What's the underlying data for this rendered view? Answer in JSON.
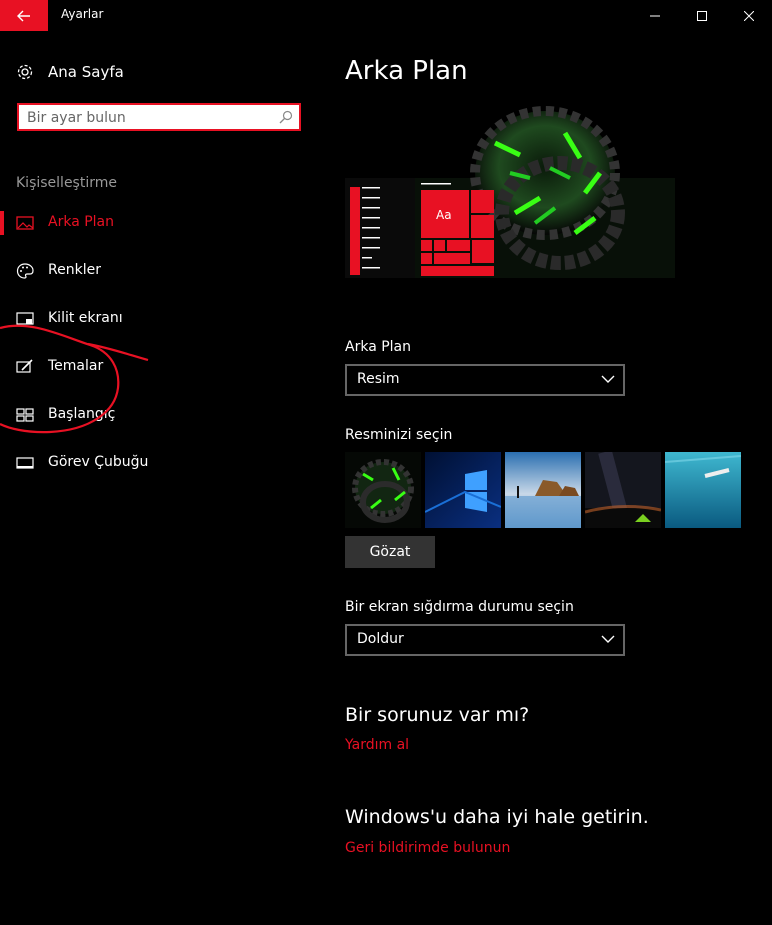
{
  "window": {
    "title": "Ayarlar"
  },
  "sidebar": {
    "home_label": "Ana Sayfa",
    "search": {
      "placeholder": "Bir ayar bulun",
      "value": ""
    },
    "section_label": "Kişiselleştirme",
    "items": [
      {
        "label": "Arka Plan",
        "icon": "image-icon",
        "active": true
      },
      {
        "label": "Renkler",
        "icon": "palette-icon",
        "active": false
      },
      {
        "label": "Kilit ekranı",
        "icon": "lock-screen-icon",
        "active": false
      },
      {
        "label": "Temalar",
        "icon": "brush-icon",
        "active": false
      },
      {
        "label": "Başlangıç",
        "icon": "start-tiles-icon",
        "active": false
      },
      {
        "label": "Görev Çubuğu",
        "icon": "taskbar-icon",
        "active": false
      }
    ]
  },
  "main": {
    "title": "Arka Plan",
    "preview_tile_label": "Aa",
    "background_label": "Arka Plan",
    "background_value": "Resim",
    "choose_picture_label": "Resminizi seçin",
    "browse_label": "Gözat",
    "fit_label": "Bir ekran sığdırma durumu seçin",
    "fit_value": "Doldur",
    "help_heading": "Bir sorunuz var mı?",
    "help_link": "Yardım al",
    "feedback_heading": "Windows'u daha iyi hale getirin.",
    "feedback_link": "Geri bildirimde bulunun"
  },
  "colors": {
    "accent": "#e81123",
    "background": "#000000",
    "text": "#ffffff",
    "muted": "#999999"
  }
}
